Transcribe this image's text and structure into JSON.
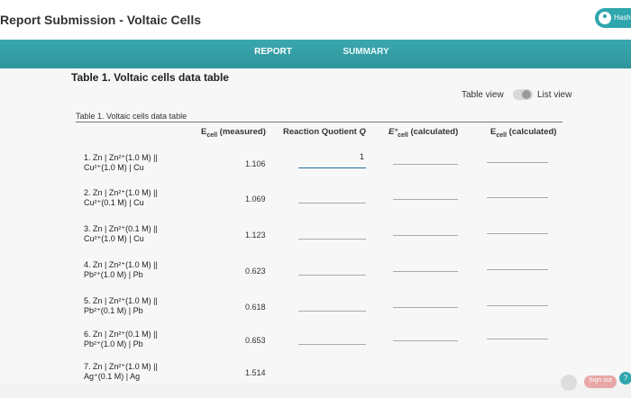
{
  "header": {
    "title": "Report Submission - Voltaic Cells",
    "user_name": "Hash",
    "avatar_icon": "user-circle-icon"
  },
  "tabs": [
    {
      "label": "REPORT",
      "active": true
    },
    {
      "label": "SUMMARY",
      "active": false
    }
  ],
  "section": {
    "title": "Table 1. Voltaic cells data table",
    "view_toggle": {
      "left_label": "Table view",
      "right_label": "List view",
      "selected": "Table view"
    }
  },
  "table": {
    "caption": "Table 1. Voltaic cells data table",
    "columns": {
      "ecell_measured": {
        "main": "E",
        "sub": "cell",
        "suffix": " (measured)"
      },
      "reaction_q": {
        "main": "Reaction Quotient ",
        "q": "Q"
      },
      "e0_calc": {
        "main": "E°",
        "sub": "cell",
        "suffix": " (calculated)"
      },
      "e_calc": {
        "main": "E",
        "sub": "cell",
        "suffix": " (calculated)"
      }
    },
    "rows": [
      {
        "line1": "1. Zn | Zn²⁺(1.0 M) ||",
        "line2": "Cu²⁺(1.0 M) | Cu",
        "measured": "1.106",
        "q": "1"
      },
      {
        "line1": "2. Zn | Zn²⁺(1.0 M) ||",
        "line2": "Cu²⁺(0.1 M) | Cu",
        "measured": "1.069",
        "q": ""
      },
      {
        "line1": "3. Zn | Zn²⁺(0.1 M) ||",
        "line2": "Cu²⁺(1.0 M) | Cu",
        "measured": "1.123",
        "q": ""
      },
      {
        "line1": "4. Zn | Zn²⁺(1.0 M) ||",
        "line2": "Pb²⁺(1.0 M) | Pb",
        "measured": "0.623",
        "q": ""
      },
      {
        "line1": "5. Zn | Zn²⁺(1.0 M) ||",
        "line2": "Pb²⁺(0.1 M) | Pb",
        "measured": "0.618",
        "q": ""
      },
      {
        "line1": "6. Zn | Zn²⁺(0.1 M) ||",
        "line2": "Pb²⁺(1.0 M) | Pb",
        "measured": "0.653",
        "q": ""
      },
      {
        "line1": "7. Zn | Zn²⁺(1.0 M) ||",
        "line2": "Ag⁺(0.1 M) | Ag",
        "measured": "1.514",
        "q": ""
      }
    ]
  },
  "footer": {
    "signout_label": "Sign out",
    "help_label": "?"
  },
  "colors": {
    "accent": "#2fa6ad",
    "tabbar": "#3aa7ae"
  }
}
